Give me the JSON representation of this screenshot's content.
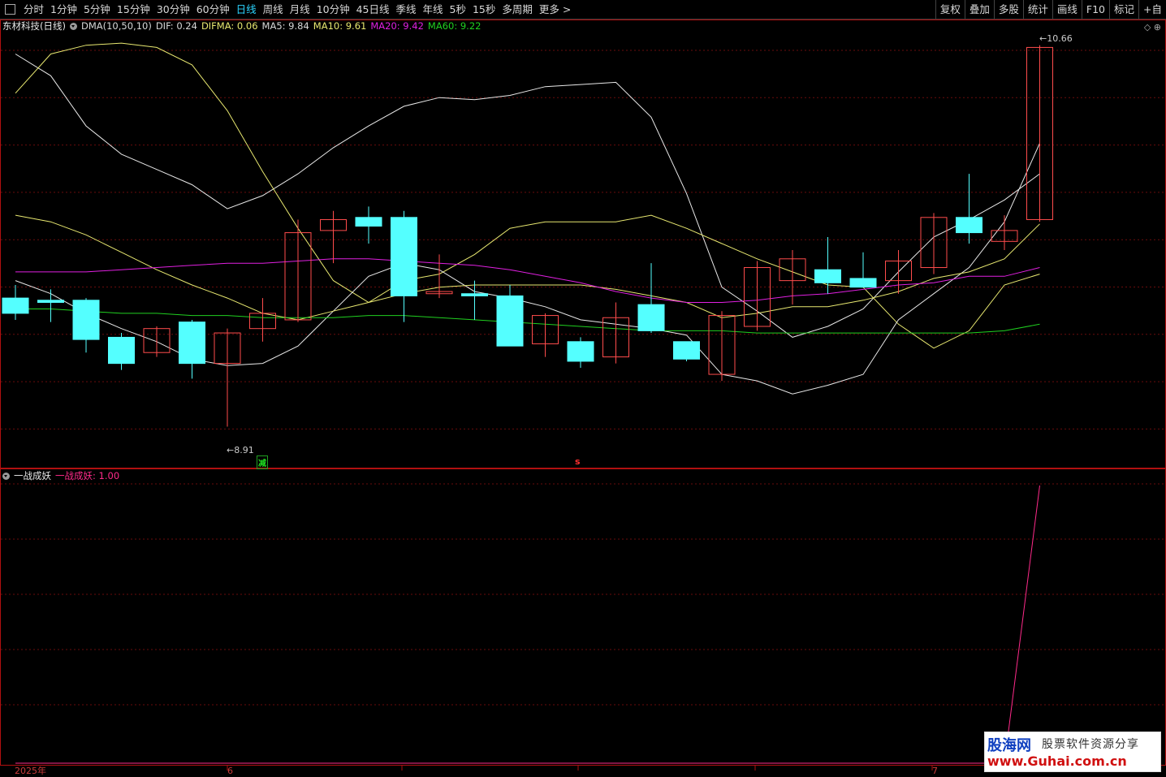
{
  "toolbar": {
    "periods": [
      "分时",
      "1分钟",
      "5分钟",
      "15分钟",
      "30分钟",
      "60分钟",
      "日线",
      "周线",
      "月线",
      "10分钟",
      "45日线",
      "季线",
      "年线",
      "5秒",
      "15秒",
      "多周期",
      "更多 >"
    ],
    "active_period": "日线",
    "right_buttons": [
      "复权",
      "叠加",
      "多股",
      "统计",
      "画线",
      "F10",
      "标记",
      "+自"
    ]
  },
  "main": {
    "stock_name": "东材科技",
    "period_tag": "(日线)",
    "indicators": [
      {
        "text": "DMA(10,50,10)",
        "color": "#d8d8d8"
      },
      {
        "text": "DIF: 0.24",
        "color": "#d8d8d8"
      },
      {
        "text": "DIFMA: 0.06",
        "color": "#e8e870"
      },
      {
        "text": "MA5: 9.84",
        "color": "#d8d8d8"
      },
      {
        "text": "MA10: 9.61",
        "color": "#e8e870"
      },
      {
        "text": "MA20: 9.42",
        "color": "#e020e0"
      },
      {
        "text": "MA60: 9.22",
        "color": "#20d020"
      }
    ],
    "high_label": "10.66",
    "low_label": "8.91",
    "signal_green": "减",
    "signal_red": "s"
  },
  "sub": {
    "name": "一战成妖",
    "value_label": "一战成妖: 1.00"
  },
  "time_axis": {
    "labels": [
      "2025年",
      "6",
      "7"
    ]
  },
  "watermark": {
    "brand": "股海网",
    "slogan": "股票软件资源分享",
    "url": "www.Guhai.com.cn"
  },
  "chart_data": {
    "type": "candlestick",
    "y_range": [
      8.8,
      10.7
    ],
    "up_color": "#ff4c4c",
    "down_color": "#54ffff",
    "candles": [
      {
        "o": 9.5,
        "c": 9.43,
        "h": 9.56,
        "l": 9.4
      },
      {
        "o": 9.49,
        "c": 9.48,
        "h": 9.54,
        "l": 9.39
      },
      {
        "o": 9.49,
        "c": 9.31,
        "h": 9.5,
        "l": 9.25
      },
      {
        "o": 9.32,
        "c": 9.2,
        "h": 9.34,
        "l": 9.17
      },
      {
        "o": 9.25,
        "c": 9.36,
        "h": 9.37,
        "l": 9.23
      },
      {
        "o": 9.39,
        "c": 9.2,
        "h": 9.4,
        "l": 9.13
      },
      {
        "o": 9.2,
        "c": 9.34,
        "h": 9.36,
        "l": 8.91
      },
      {
        "o": 9.36,
        "c": 9.43,
        "h": 9.5,
        "l": 9.3
      },
      {
        "o": 9.4,
        "c": 9.8,
        "h": 9.86,
        "l": 9.39
      },
      {
        "o": 9.81,
        "c": 9.86,
        "h": 9.9,
        "l": 9.66
      },
      {
        "o": 9.87,
        "c": 9.83,
        "h": 9.92,
        "l": 9.75
      },
      {
        "o": 9.87,
        "c": 9.51,
        "h": 9.9,
        "l": 9.39
      },
      {
        "o": 9.52,
        "c": 9.53,
        "h": 9.7,
        "l": 9.5
      },
      {
        "o": 9.52,
        "c": 9.51,
        "h": 9.58,
        "l": 9.4
      },
      {
        "o": 9.51,
        "c": 9.28,
        "h": 9.56,
        "l": 9.28
      },
      {
        "o": 9.29,
        "c": 9.42,
        "h": 9.43,
        "l": 9.23
      },
      {
        "o": 9.3,
        "c": 9.21,
        "h": 9.32,
        "l": 9.18
      },
      {
        "o": 9.23,
        "c": 9.41,
        "h": 9.48,
        "l": 9.2
      },
      {
        "o": 9.47,
        "c": 9.35,
        "h": 9.66,
        "l": 9.34
      },
      {
        "o": 9.3,
        "c": 9.22,
        "h": 9.3,
        "l": 9.21
      },
      {
        "o": 9.15,
        "c": 9.42,
        "h": 9.44,
        "l": 9.12
      },
      {
        "o": 9.37,
        "c": 9.64,
        "h": 9.67,
        "l": 9.35
      },
      {
        "o": 9.58,
        "c": 9.68,
        "h": 9.72,
        "l": 9.47
      },
      {
        "o": 9.63,
        "c": 9.57,
        "h": 9.78,
        "l": 9.52
      },
      {
        "o": 9.59,
        "c": 9.55,
        "h": 9.71,
        "l": 9.55
      },
      {
        "o": 9.58,
        "c": 9.67,
        "h": 9.72,
        "l": 9.52
      },
      {
        "o": 9.64,
        "c": 9.87,
        "h": 9.89,
        "l": 9.61
      },
      {
        "o": 9.87,
        "c": 9.8,
        "h": 10.07,
        "l": 9.75
      },
      {
        "o": 9.76,
        "c": 9.81,
        "h": 9.88,
        "l": 9.72
      },
      {
        "o": 9.86,
        "c": 10.65,
        "h": 10.66,
        "l": 9.85
      }
    ],
    "lines": [
      {
        "name": "MA5",
        "color": "#e8e8e8",
        "values": [
          10.62,
          10.52,
          10.29,
          10.16,
          10.09,
          10.02,
          9.91,
          9.97,
          10.07,
          10.19,
          10.29,
          10.38,
          10.42,
          10.41,
          10.43,
          10.47,
          10.48,
          10.49,
          10.33,
          9.98,
          9.55,
          9.44,
          9.32,
          9.37,
          9.45,
          9.62,
          9.78,
          9.86,
          9.95,
          10.07
        ]
      },
      {
        "name": "MA10",
        "color": "#e8e870",
        "values": [
          10.44,
          10.62,
          10.66,
          10.67,
          10.65,
          10.57,
          10.36,
          10.08,
          9.82,
          9.58,
          9.48,
          9.58,
          9.61,
          9.7,
          9.82,
          9.85,
          9.85,
          9.85,
          9.88,
          9.82,
          9.75,
          9.68,
          9.62,
          9.56,
          9.55,
          9.38,
          9.27,
          9.35,
          9.56,
          9.61
        ]
      },
      {
        "name": "DIF",
        "color": "#e8e8e8",
        "values": [
          9.58,
          9.52,
          9.43,
          9.36,
          9.3,
          9.22,
          9.19,
          9.2,
          9.28,
          9.44,
          9.6,
          9.66,
          9.63,
          9.53,
          9.5,
          9.46,
          9.4,
          9.38,
          9.36,
          9.33,
          9.15,
          9.12,
          9.06,
          9.1,
          9.15,
          9.4,
          9.52,
          9.64,
          9.85,
          10.21
        ]
      },
      {
        "name": "DIFMA",
        "color": "#e8e870",
        "values": [
          9.88,
          9.85,
          9.79,
          9.71,
          9.63,
          9.56,
          9.5,
          9.43,
          9.4,
          9.44,
          9.48,
          9.52,
          9.55,
          9.56,
          9.56,
          9.56,
          9.56,
          9.54,
          9.51,
          9.48,
          9.41,
          9.43,
          9.46,
          9.46,
          9.49,
          9.53,
          9.59,
          9.62,
          9.68,
          9.84
        ]
      },
      {
        "name": "MA20",
        "color": "#e020e0",
        "values": [
          9.62,
          9.62,
          9.62,
          9.63,
          9.64,
          9.65,
          9.66,
          9.66,
          9.67,
          9.68,
          9.68,
          9.67,
          9.66,
          9.65,
          9.63,
          9.6,
          9.57,
          9.53,
          9.5,
          9.48,
          9.48,
          9.49,
          9.51,
          9.52,
          9.54,
          9.56,
          9.57,
          9.6,
          9.6,
          9.64
        ]
      },
      {
        "name": "MA60",
        "color": "#20d020",
        "values": [
          9.45,
          9.45,
          9.44,
          9.43,
          9.43,
          9.42,
          9.42,
          9.41,
          9.41,
          9.41,
          9.42,
          9.42,
          9.41,
          9.4,
          9.39,
          9.38,
          9.37,
          9.36,
          9.35,
          9.35,
          9.35,
          9.34,
          9.34,
          9.34,
          9.34,
          9.34,
          9.34,
          9.34,
          9.35,
          9.38
        ]
      }
    ],
    "sub_series": {
      "name": "一战成妖",
      "color": "#ff2a8a",
      "values": [
        0,
        0,
        0,
        0,
        0,
        0,
        0,
        0,
        0,
        0,
        0,
        0,
        0,
        0,
        0,
        0,
        0,
        0,
        0,
        0,
        0,
        0,
        0,
        0,
        0,
        0,
        0,
        0,
        0,
        1
      ]
    }
  }
}
